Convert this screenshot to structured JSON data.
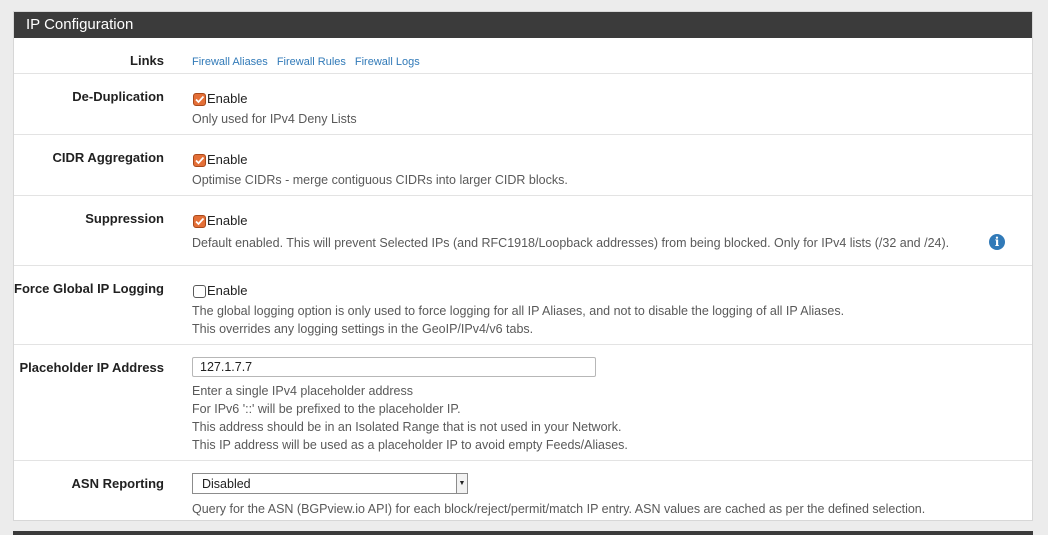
{
  "panel": {
    "title": "IP Configuration"
  },
  "links": {
    "label": "Links",
    "items": [
      "Firewall Aliases",
      "Firewall Rules",
      "Firewall Logs"
    ]
  },
  "dedup": {
    "label": "De-Duplication",
    "checkbox_label": "Enable",
    "checked": true,
    "help": [
      "Only used for IPv4 Deny Lists"
    ]
  },
  "cidr": {
    "label": "CIDR Aggregation",
    "checkbox_label": "Enable",
    "checked": true,
    "help": [
      "Optimise CIDRs - merge contiguous CIDRs into larger CIDR blocks."
    ]
  },
  "suppression": {
    "label": "Suppression",
    "checkbox_label": "Enable",
    "checked": true,
    "help": [
      "Default enabled. This will prevent Selected IPs (and RFC1918/Loopback addresses) from being blocked. Only for IPv4 lists (/32 and /24)."
    ],
    "info_icon": "info-circle-icon"
  },
  "global_logging": {
    "label": "Force Global IP Logging",
    "checkbox_label": "Enable",
    "checked": false,
    "help": [
      "The global logging option is only used to force logging for all IP Aliases, and not to disable the logging of all IP Aliases.",
      "This overrides any logging settings in the GeoIP/IPv4/v6 tabs."
    ]
  },
  "placeholder_ip": {
    "label": "Placeholder IP Address",
    "value": "127.1.7.7",
    "help": [
      "Enter a single IPv4 placeholder address",
      "For IPv6 '::' will be prefixed to the placeholder IP.",
      "This address should be in an Isolated Range that is not used in your Network.",
      "This IP address will be used as a placeholder IP to avoid empty Feeds/Aliases."
    ]
  },
  "asn": {
    "label": "ASN Reporting",
    "selected": "Disabled",
    "help": [
      "Query for the ASN (BGPview.io API) for each block/reject/permit/match IP entry. ASN values are cached as per the defined selection."
    ]
  },
  "colors": {
    "header_bg": "#3b3b3b",
    "checkbox_checked": "#e46f37",
    "link": "#317ab8"
  }
}
